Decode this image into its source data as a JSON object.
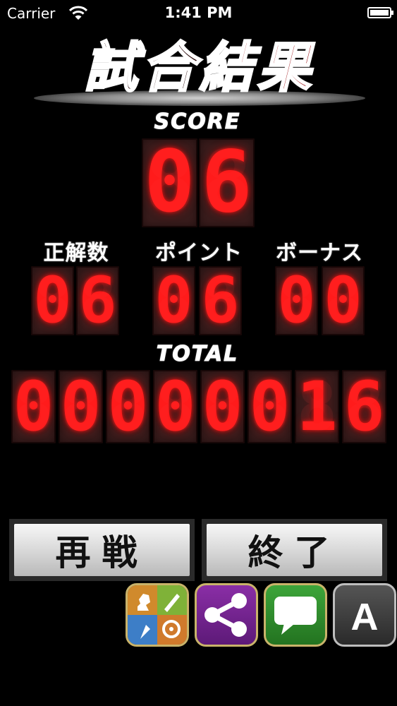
{
  "status_bar": {
    "carrier": "Carrier",
    "time": "1:41 PM"
  },
  "title": {
    "part1": "試合",
    "part2": "結果"
  },
  "score": {
    "label": "SCORE",
    "digits": [
      "0",
      "6"
    ]
  },
  "breakdown": {
    "correct": {
      "label": "正解数",
      "digits": [
        "0",
        "6"
      ]
    },
    "points": {
      "label": "ポイント",
      "digits": [
        "0",
        "6"
      ]
    },
    "bonus": {
      "label": "ボーナス",
      "digits": [
        "0",
        "0"
      ]
    }
  },
  "total": {
    "label": "TOTAL",
    "digits": [
      "0",
      "0",
      "0",
      "0",
      "0",
      "0",
      "1",
      "6"
    ]
  },
  "buttons": {
    "retry": "再戦",
    "finish": "終了"
  },
  "apps": {
    "letter_app": "A"
  },
  "colors": {
    "digit": "#ff1b1b",
    "cell_bg": "#3a1c1c",
    "title_red": "#9c0f14"
  }
}
